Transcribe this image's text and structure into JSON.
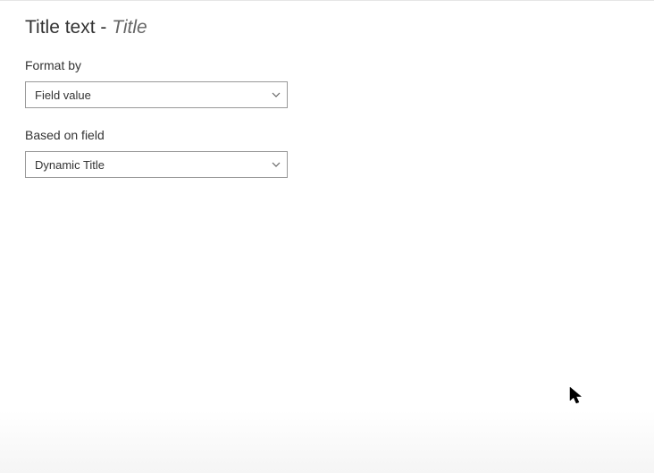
{
  "header": {
    "title_prefix": "Title text - ",
    "title_suffix": "Title"
  },
  "fields": {
    "format_by": {
      "label": "Format by",
      "value": "Field value"
    },
    "based_on_field": {
      "label": "Based on field",
      "value": "Dynamic Title"
    }
  }
}
